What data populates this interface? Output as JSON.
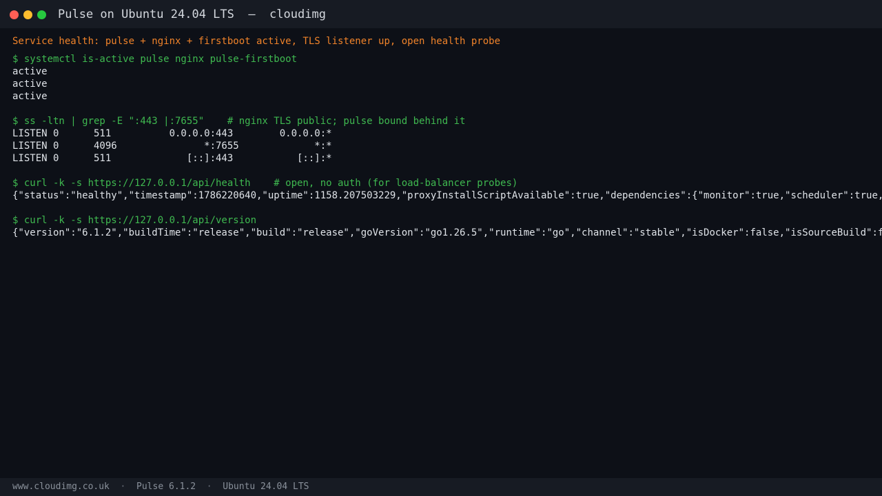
{
  "window": {
    "title": "Pulse on Ubuntu 24.04 LTS  —  cloudimg",
    "controls": [
      "close",
      "minimize",
      "maximize"
    ]
  },
  "terminal": {
    "banner": "Service health: pulse + nginx + firstboot active, TLS listener up, open health probe",
    "lines": [
      {
        "type": "cmd",
        "text": "$ systemctl is-active pulse nginx pulse-firstboot"
      },
      {
        "type": "out",
        "text": "active"
      },
      {
        "type": "out",
        "text": "active"
      },
      {
        "type": "out",
        "text": "active"
      },
      {
        "type": "blank",
        "text": ""
      },
      {
        "type": "cmd",
        "text": "$ ss -ltn | grep -E \":443 |:7655\"    # nginx TLS public; pulse bound behind it"
      },
      {
        "type": "out",
        "text": "LISTEN 0      511          0.0.0.0:443        0.0.0.0:*"
      },
      {
        "type": "out",
        "text": "LISTEN 0      4096               *:7655             *:*"
      },
      {
        "type": "out",
        "text": "LISTEN 0      511             [::]:443           [::]:*"
      },
      {
        "type": "blank",
        "text": ""
      },
      {
        "type": "cmd",
        "text": "$ curl -k -s https://127.0.0.1/api/health    # open, no auth (for load-balancer probes)"
      },
      {
        "type": "out",
        "text": "{\"status\":\"healthy\",\"timestamp\":1786220640,\"uptime\":1158.207503229,\"proxyInstallScriptAvailable\":true,\"dependencies\":{\"monitor\":true,\"scheduler\":true,"
      },
      {
        "type": "blank",
        "text": ""
      },
      {
        "type": "cmd",
        "text": "$ curl -k -s https://127.0.0.1/api/version"
      },
      {
        "type": "out",
        "text": "{\"version\":\"6.1.2\",\"buildTime\":\"release\",\"build\":\"release\",\"goVersion\":\"go1.26.5\",\"runtime\":\"go\",\"channel\":\"stable\",\"isDocker\":false,\"isSourceBuild\":f"
      }
    ]
  },
  "statusbar": {
    "site": "www.cloudimg.co.uk",
    "product": "Pulse 6.1.2",
    "os": "Ubuntu 24.04 LTS",
    "separator": "·"
  },
  "colors": {
    "background": "#0d1017",
    "titlebar": "#171b23",
    "command": "#3fb950",
    "banner": "#f0832a",
    "output": "#dfe3e8"
  }
}
